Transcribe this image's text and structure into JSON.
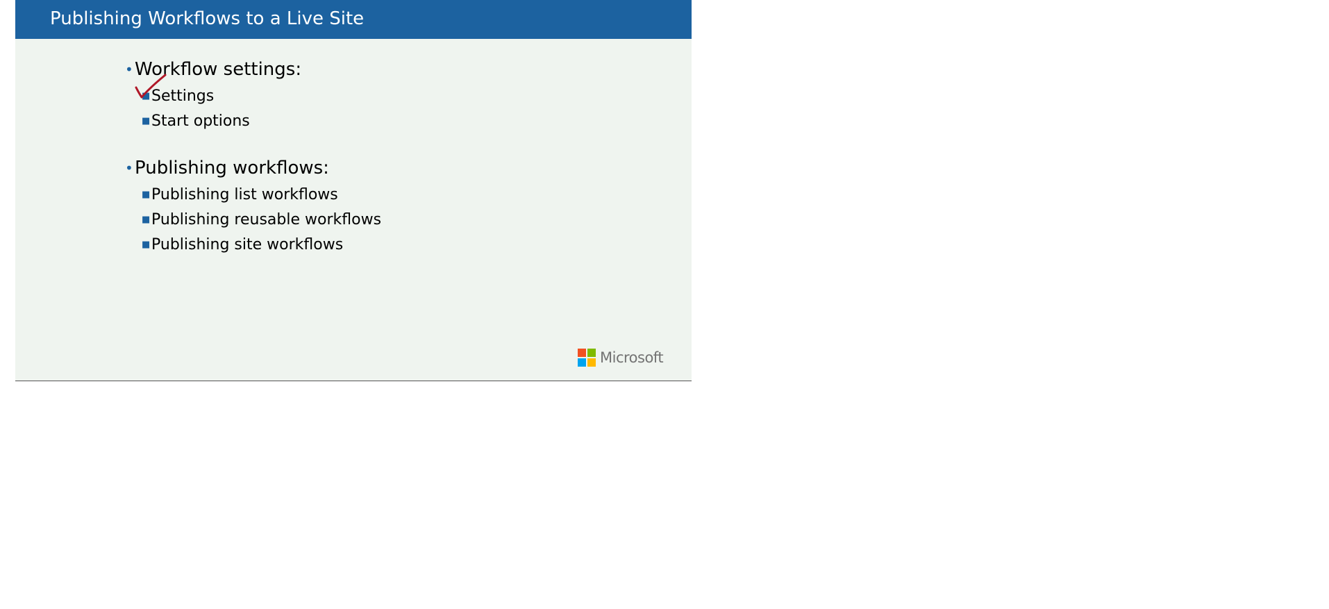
{
  "slide": {
    "title": "Publishing Workflows to a Live Site",
    "sections": [
      {
        "heading": "Workflow settings:",
        "items": [
          "Settings",
          "Start options"
        ]
      },
      {
        "heading": "Publishing workflows:",
        "items": [
          "Publishing list workflows",
          "Publishing reusable workflows",
          "Publishing site workflows"
        ]
      }
    ],
    "annotation": "checkmark-icon",
    "logo": {
      "text": "Microsoft",
      "colors": [
        "#f25022",
        "#7fba00",
        "#00a4ef",
        "#ffb900"
      ]
    }
  },
  "colors": {
    "title_bar": "#1c62a0",
    "background": "#eff4ef",
    "bullet": "#1c62a0",
    "ink": "#b01828"
  }
}
